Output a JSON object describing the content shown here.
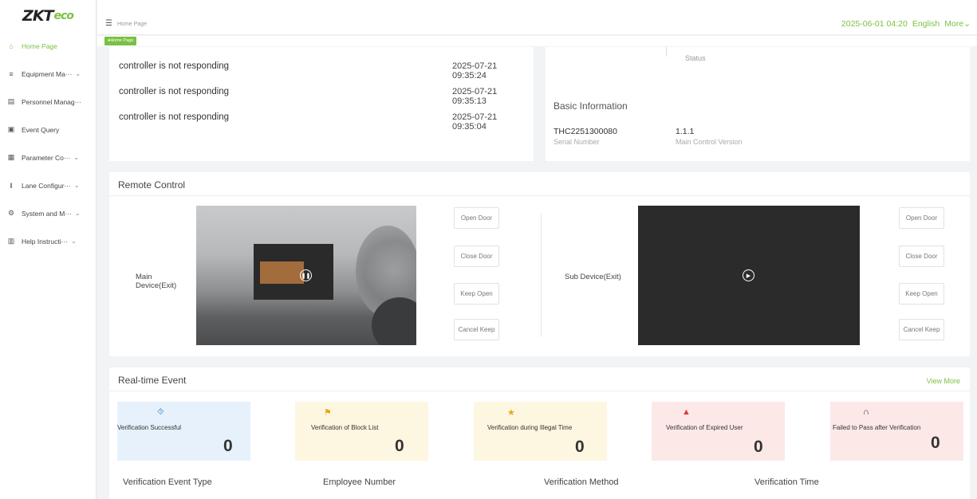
{
  "app": {
    "logo_main": "ZKT",
    "logo_accent": "eco",
    "breadcrumb": "Home Page",
    "home_tab": "●Home Page",
    "datetime": "2025-06-01 04:20",
    "language": "English",
    "more": "More⌄",
    "accent_color": "#7ac143"
  },
  "sidebar": {
    "items": [
      {
        "label": "Home Page",
        "icon": "home-icon",
        "glyph": "⌂",
        "chevron": ""
      },
      {
        "label": "Equipment Ma···",
        "icon": "equipment-icon",
        "glyph": "≡",
        "chevron": "⌄"
      },
      {
        "label": "Personnel Manag···",
        "icon": "personnel-icon",
        "glyph": "▤",
        "chevron": ""
      },
      {
        "label": "Event Query",
        "icon": "event-icon",
        "glyph": "▣",
        "chevron": ""
      },
      {
        "label": "Parameter Co···",
        "icon": "parameter-icon",
        "glyph": "▦",
        "chevron": "⌄"
      },
      {
        "label": "Lane Configur···",
        "icon": "lane-icon",
        "glyph": "‖",
        "chevron": "⌄"
      },
      {
        "label": "System and M···",
        "icon": "system-icon",
        "glyph": "⚙",
        "chevron": "⌄"
      },
      {
        "label": "Help Instructi···",
        "icon": "help-icon",
        "glyph": "▥",
        "chevron": "⌄"
      }
    ]
  },
  "alarms": [
    {
      "message": "controller is not responding",
      "time": "2025-07-21 09:35:24"
    },
    {
      "message": "controller is not responding",
      "time": "2025-07-21 09:35:13"
    },
    {
      "message": "controller is not responding",
      "time": "2025-07-21 09:35:04"
    }
  ],
  "device_info": {
    "status_label": "Status",
    "title": "Basic Information",
    "serial_value": "THC2251300080",
    "serial_label": "Serial Number",
    "version_value": "1.1.1",
    "version_label": "Main Control Version"
  },
  "remote": {
    "title": "Remote Control",
    "main_label": "Main Device(Exit)",
    "sub_label": "Sub Device(Exit)",
    "buttons": [
      "Open Door",
      "Close Door",
      "Keep Open",
      "Cancel Keep"
    ],
    "main_play_icon": "pause-icon",
    "sub_play_icon": "play-icon"
  },
  "events": {
    "title": "Real-time Event",
    "view_more": "View More",
    "stats": [
      {
        "label": "Verification Successful",
        "value": "0",
        "icon": "shield-check-icon",
        "glyph": "⯑",
        "bg": "#e6f1fb",
        "icon_color": "#4a90d9"
      },
      {
        "label": "Verification of Block List",
        "value": "0",
        "icon": "block-list-icon",
        "glyph": "⚑",
        "bg": "#fdf6e1",
        "icon_color": "#e6a817"
      },
      {
        "label": "Verification during Illegal Time",
        "value": "0",
        "icon": "illegal-time-icon",
        "glyph": "★",
        "bg": "#fdf6e1",
        "icon_color": "#e6a817"
      },
      {
        "label": "Verification of Expired User",
        "value": "0",
        "icon": "expired-user-icon",
        "glyph": "▲",
        "bg": "#fde8e8",
        "icon_color": "#e03a3a"
      },
      {
        "label": "Failed to Pass after Verification",
        "value": "0",
        "icon": "failed-pass-icon",
        "glyph": "∩",
        "bg": "#fde8e8",
        "icon_color": "#333333"
      }
    ],
    "columns": [
      "Verification Event Type",
      "Employee Number",
      "Verification Method",
      "Verification Time"
    ]
  }
}
